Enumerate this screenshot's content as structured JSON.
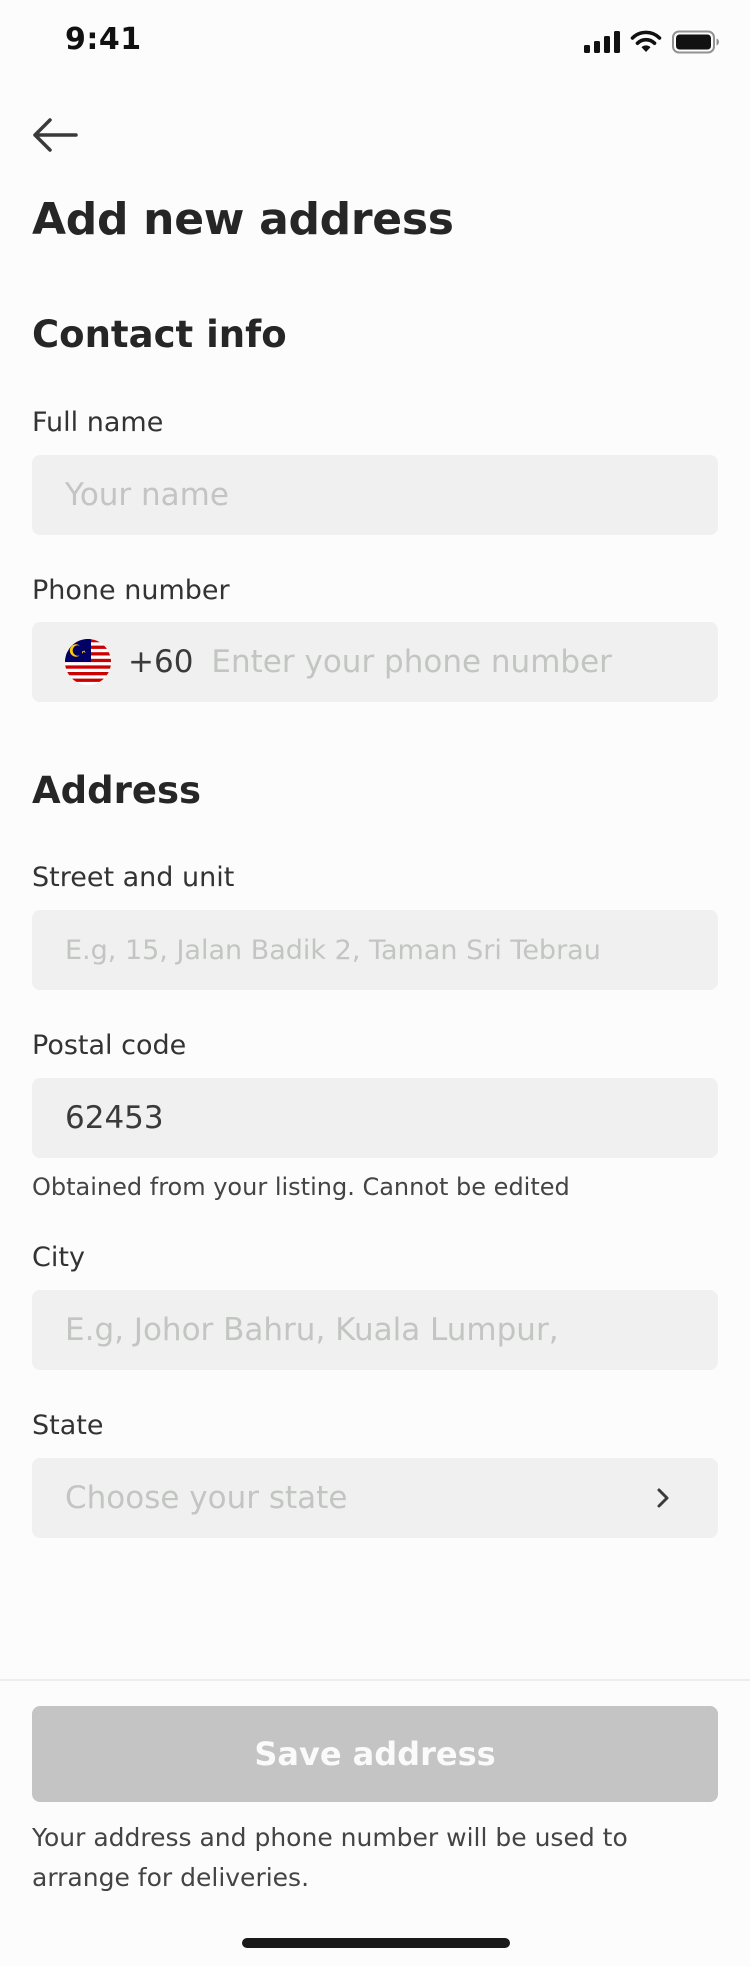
{
  "status_bar": {
    "time": "9:41",
    "icons": [
      "cellular-signal-icon",
      "wifi-icon",
      "battery-icon"
    ]
  },
  "header": {
    "back_icon": "arrow-left-icon",
    "title": "Add new address"
  },
  "contact": {
    "section_title": "Contact info",
    "full_name": {
      "label": "Full name",
      "placeholder": "Your name",
      "value": ""
    },
    "phone": {
      "label": "Phone number",
      "flag": "malaysia-flag-icon",
      "country_code": "+60",
      "placeholder": "Enter your phone number",
      "value": ""
    }
  },
  "address": {
    "section_title": "Address",
    "street": {
      "label": "Street and unit",
      "placeholder": "E.g, 15, Jalan Badik 2, Taman Sri Tebrau",
      "value": ""
    },
    "postal": {
      "label": "Postal code",
      "value": "62453",
      "help": "Obtained from your listing. Cannot be edited"
    },
    "city": {
      "label": "City",
      "placeholder": "E.g, Johor Bahru, Kuala Lumpur,",
      "value": ""
    },
    "state": {
      "label": "State",
      "placeholder": "Choose your state",
      "icon": "chevron-right-icon"
    }
  },
  "footer": {
    "save_label": "Save address",
    "note": "Your address and phone number will be used to arrange for deliveries."
  },
  "colors": {
    "field_bg": "#eff0ef",
    "placeholder": "#c3c5c3",
    "button_disabled": "#c4c4c4",
    "title": "#262626"
  }
}
